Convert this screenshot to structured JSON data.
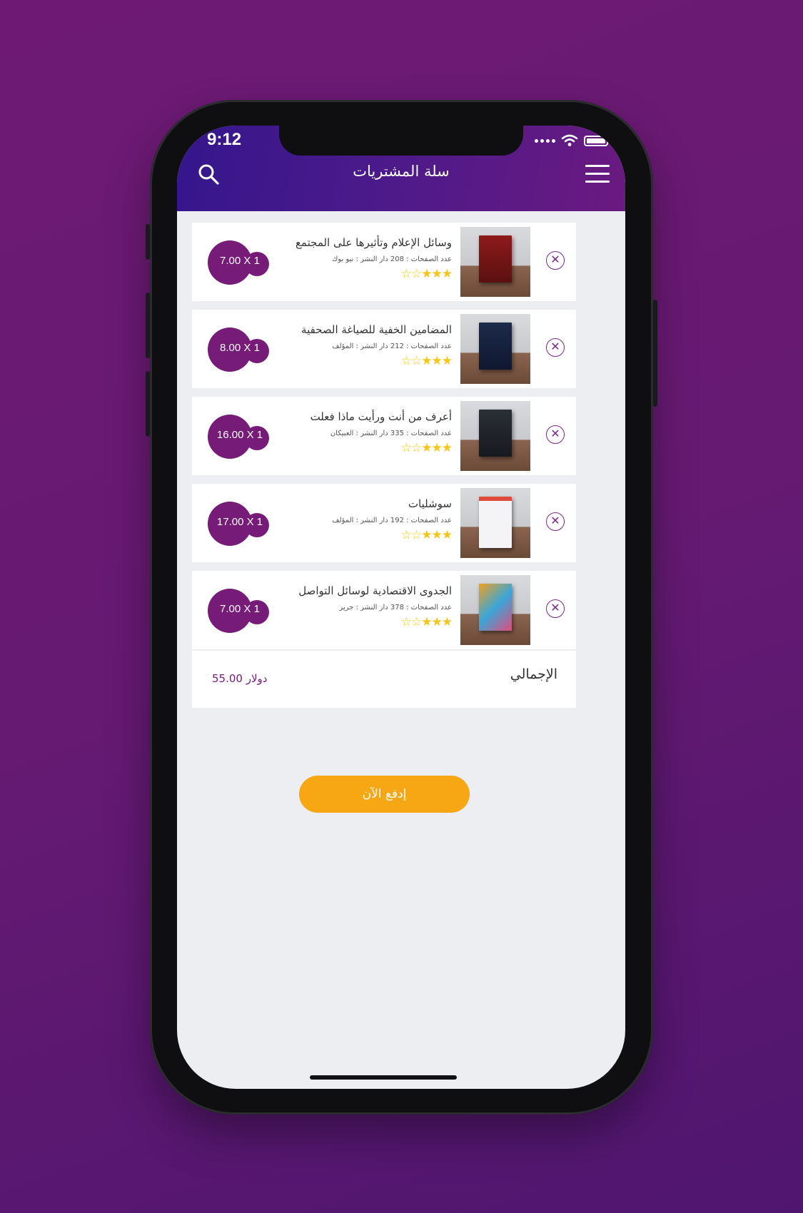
{
  "status_bar": {
    "time": "9:12"
  },
  "header": {
    "title": "سلة المشتريات",
    "search_icon": "search-icon",
    "menu_icon": "hamburger-menu-icon"
  },
  "colors": {
    "brand_purple": "#761c78",
    "header_gradient_start": "#34168c",
    "accent_yellow": "#f7a714",
    "star_color": "#f5c518"
  },
  "cart": {
    "items": [
      {
        "title": "وسائل الإعلام وتأثيرها على المجتمع",
        "meta": "عدد الصفحات : 208 دار النشر : نيو بوك",
        "rating": 3,
        "rating_max": 5,
        "price_label": "7.00 X 1"
      },
      {
        "title": "المضامين الخفية للصياغة الصحفية",
        "meta": "عدد الصفحات : 212   دار النشر : المؤلف",
        "rating": 3,
        "rating_max": 5,
        "price_label": "8.00 X 1"
      },
      {
        "title": "أعرف من أنت ورأيت ماذا فعلت",
        "meta": "عدد الصفحات : 335 دار النشر : العبيكان",
        "rating": 3,
        "rating_max": 5,
        "price_label": "16.00 X 1"
      },
      {
        "title": "سوشليات",
        "meta": "عدد الصفحات : 192 دار النشر : المؤلف",
        "rating": 3,
        "rating_max": 5,
        "price_label": "17.00 X 1"
      },
      {
        "title": "الجدوى الاقتصادية لوسائل التواصل",
        "meta": "عدد الصفحات : 378 دار النشر : جرير",
        "rating": 3,
        "rating_max": 5,
        "price_label": "7.00 X 1"
      }
    ],
    "total_label": "الإجمالي",
    "total_amount": "55.00 دولار",
    "pay_button": "إدفع الآن"
  }
}
